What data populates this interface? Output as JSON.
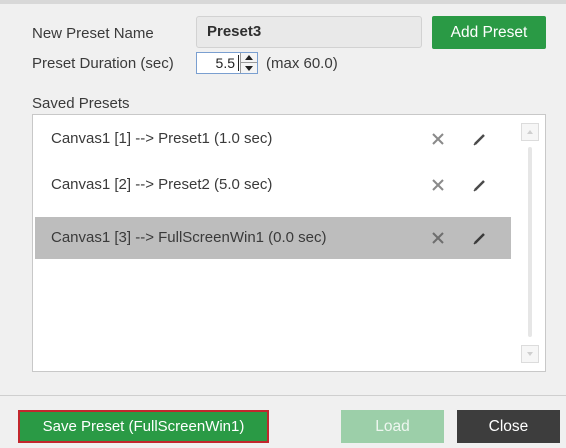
{
  "form": {
    "name_label": "New Preset Name",
    "name_value": "Preset3",
    "add_button": "Add Preset",
    "duration_label": "Preset Duration (sec)",
    "duration_value": "5.5",
    "duration_max": "(max 60.0)"
  },
  "saved": {
    "label": "Saved Presets",
    "items": [
      {
        "text": "Canvas1 [1] --> Preset1 (1.0 sec)",
        "selected": false
      },
      {
        "text": "Canvas1 [2] --> Preset2 (5.0 sec)",
        "selected": false
      },
      {
        "text": "Canvas1 [3] --> FullScreenWin1 (0.0 sec)",
        "selected": true
      }
    ]
  },
  "footer": {
    "save_button": "Save Preset (FullScreenWin1)",
    "load_button": "Load",
    "close_button": "Close"
  },
  "colors": {
    "accent_green": "#2a9a45",
    "disabled_green": "#9ccfa9",
    "highlight_border": "#c2272d",
    "selected_row": "#bdbdbd",
    "dark_button": "#3d3d3d"
  },
  "icons": {
    "delete": "close-x-icon",
    "edit": "pencil-icon",
    "spin_up": "triangle-up-icon",
    "spin_down": "triangle-down-icon"
  }
}
